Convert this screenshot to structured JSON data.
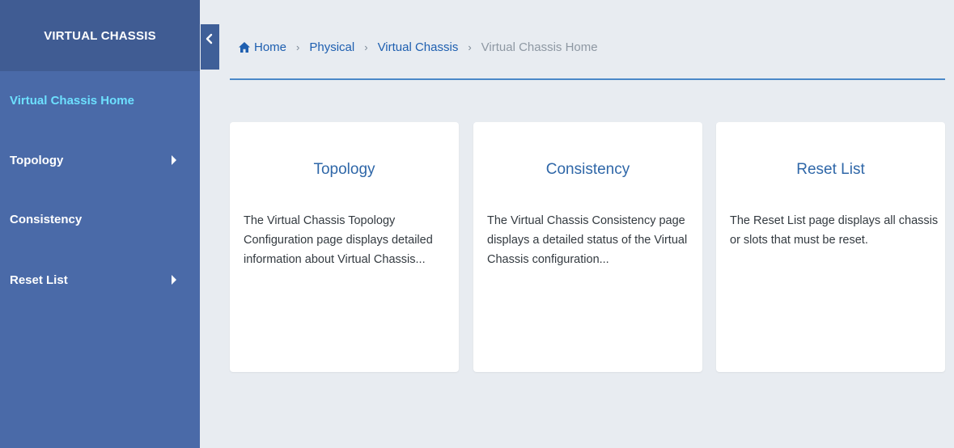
{
  "sidebar": {
    "title": "VIRTUAL CHASSIS",
    "items": [
      {
        "label": "Virtual Chassis Home",
        "active": true,
        "has_submenu": false
      },
      {
        "label": "Topology",
        "active": false,
        "has_submenu": true
      },
      {
        "label": "Consistency",
        "active": false,
        "has_submenu": false
      },
      {
        "label": "Reset List",
        "active": false,
        "has_submenu": true
      }
    ]
  },
  "collapse_button": {
    "icon": "chevron-left-icon"
  },
  "breadcrumb": {
    "home": "Home",
    "physical": "Physical",
    "virtual_chassis": "Virtual Chassis",
    "current": "Virtual Chassis Home"
  },
  "cards": [
    {
      "title": "Topology",
      "description": "The Virtual Chassis Topology Configuration page displays detailed information about Virtual Chassis..."
    },
    {
      "title": "Consistency",
      "description": "The Virtual Chassis Consistency page displays a detailed status of the Virtual Chassis configuration..."
    },
    {
      "title": "Reset List",
      "description": "The Reset List page displays all chassis or slots that must be reset."
    }
  ],
  "colors": {
    "sidebar_bg": "#4a6aa8",
    "sidebar_header_bg": "#405c93",
    "active_item": "#6de0ff",
    "link": "#1e5fb0",
    "card_title": "#2f67a8",
    "page_bg": "#e8ecf1",
    "divider": "#4a88c8"
  }
}
